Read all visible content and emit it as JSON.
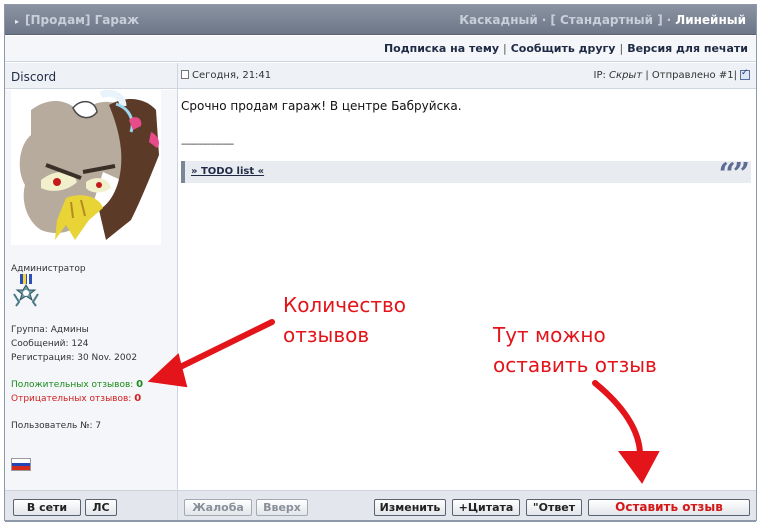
{
  "topic": {
    "title": "[Продам] Гараж",
    "view_modes": [
      "Каскадный",
      "[ Стандартный ]",
      "Линейный"
    ],
    "active_mode_index": 2
  },
  "options": [
    "Подписка на тему",
    "Сообщить другу",
    "Версия для печати"
  ],
  "post": {
    "author": "Discord",
    "date": "Сегодня, 21:41",
    "ip_label": "IP:",
    "ip_value": "Скрыт",
    "sent_label": "Отправлено",
    "post_number": "#1",
    "body": "Срочно продам гараж! В центре Бабруйска.",
    "signature_rule": "--------------------",
    "todo_link": "» TODO list «",
    "quote_icon": "quote-marks-icon"
  },
  "profile": {
    "role": "Администратор",
    "group": "Группа: Админы",
    "messages": "Сообщений: 124",
    "registration": "Регистрация: 30 Nov. 2002",
    "positive_label": "Положительных отзывов:",
    "positive_value": "0",
    "negative_label": "Отрицательных отзывов:",
    "negative_value": "0",
    "user_number": "Пользователь №: 7",
    "flag": "russia-flag-icon"
  },
  "buttons": {
    "online": "В сети",
    "pm": "ЛС",
    "complaint": "Жалоба",
    "up": "Вверх",
    "edit": "Изменить",
    "quote": "+Цитата",
    "reply": "\"Ответ",
    "leave_review": "Оставить отзыв"
  },
  "annotations": {
    "reviews_count": [
      "Количество",
      "отзывов"
    ],
    "leave_review_here": [
      "Тут можно",
      "оставить отзыв"
    ]
  },
  "colors": {
    "positive": "#1d8a1d",
    "negative": "#d02020",
    "annotation": "#e3141a"
  }
}
